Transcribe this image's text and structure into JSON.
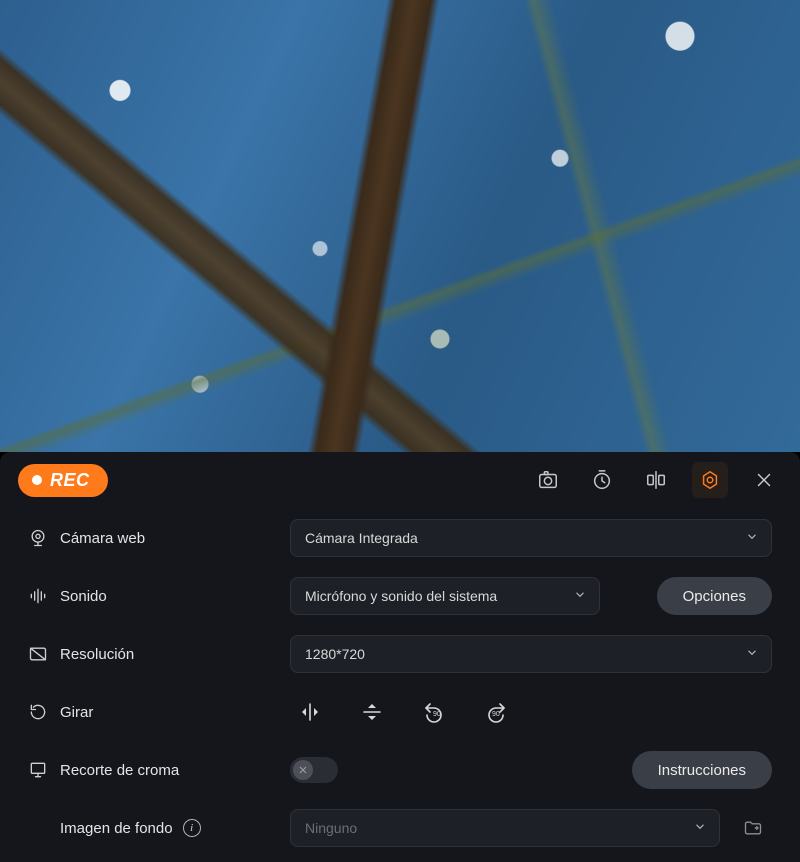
{
  "rec_label": "REC",
  "rows": {
    "webcam": {
      "label": "Cámara web",
      "value": "Cámara Integrada"
    },
    "sound": {
      "label": "Sonido",
      "value": "Micrófono y sonido del sistema",
      "options_btn": "Opciones"
    },
    "resolution": {
      "label": "Resolución",
      "value": "1280*720"
    },
    "rotate": {
      "label": "Girar"
    },
    "chroma": {
      "label": "Recorte de croma",
      "instructions_btn": "Instrucciones"
    },
    "background": {
      "label": "Imagen de fondo",
      "value": "Ninguno"
    }
  }
}
